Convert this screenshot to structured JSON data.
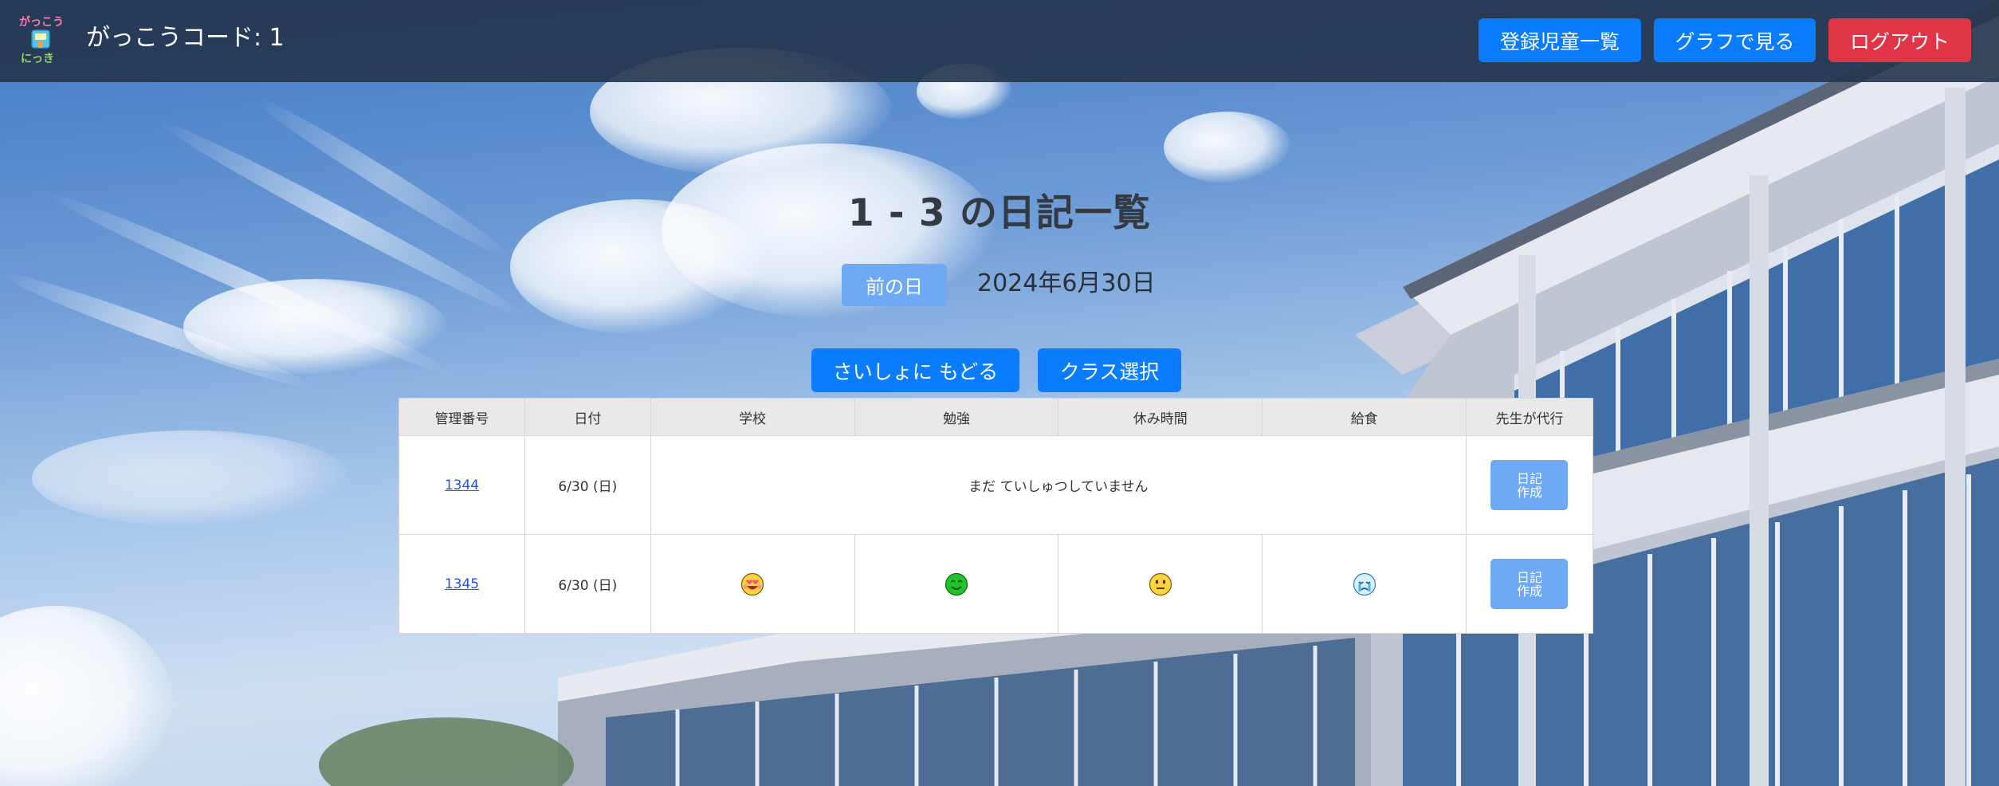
{
  "header": {
    "school_code": "がっこうコード: 1",
    "buttons": {
      "student_list": "登録児童一覧",
      "view_graph": "グラフで見る",
      "logout": "ログアウト"
    }
  },
  "main": {
    "title": "1 - 3 の日記一覧",
    "prev_day": "前の日",
    "current_date": "2024年6月30日",
    "back_to_start": "さいしょに もどる",
    "class_select": "クラス選択"
  },
  "table": {
    "columns": [
      "管理番号",
      "日付",
      "学校",
      "勉強",
      "休み時間",
      "給食",
      "先生が代行"
    ],
    "rows": [
      {
        "id": "1344",
        "date": "6/30 (日)",
        "message": "まだ ていしゅつしていません",
        "action": "日記作成",
        "action_line1": "日記",
        "action_line2": "作成"
      },
      {
        "id": "1345",
        "date": "6/30 (日)",
        "school": "grinning-hearts-face-icon",
        "study": "green-smiley-icon",
        "recess": "neutral-face-icon",
        "lunch": "crying-face-icon",
        "action": "日記作成",
        "action_line1": "日記",
        "action_line2": "作成"
      }
    ]
  },
  "colors": {
    "primary_blue": "#0a7cff",
    "light_blue": "#6fa8f5",
    "logout_red": "#e03546",
    "header_bg": "#24344b"
  }
}
